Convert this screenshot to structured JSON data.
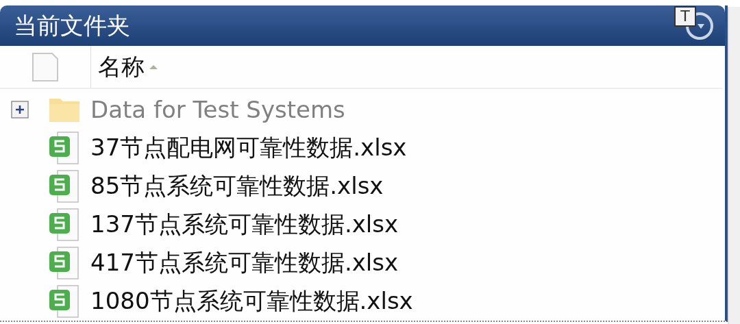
{
  "panel": {
    "title": "当前文件夹",
    "title_button": "T"
  },
  "table": {
    "columns": [
      {
        "label": "名称",
        "sorted_ascending": true
      }
    ],
    "rows": [
      {
        "kind": "folder",
        "name": "Data for Test Systems",
        "expanded": false
      },
      {
        "kind": "spreadsheet",
        "name": "37节点配电网可靠性数据.xlsx"
      },
      {
        "kind": "spreadsheet",
        "name": "85节点系统可靠性数据.xlsx"
      },
      {
        "kind": "spreadsheet",
        "name": "137节点系统可靠性数据.xlsx"
      },
      {
        "kind": "spreadsheet",
        "name": "417节点系统可靠性数据.xlsx"
      },
      {
        "kind": "spreadsheet",
        "name": "1080节点系统可靠性数据.xlsx"
      }
    ]
  }
}
